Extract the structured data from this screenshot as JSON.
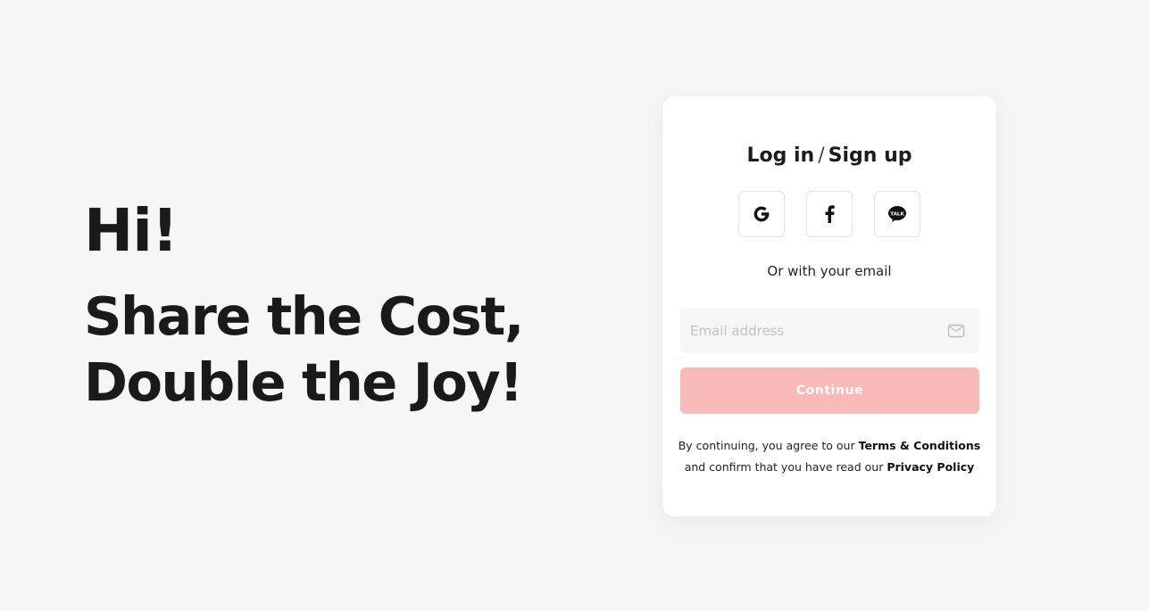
{
  "hero": {
    "greeting": "Hi!",
    "tagline_line1": "Share the Cost,",
    "tagline_line2": "Double the Joy!"
  },
  "auth": {
    "title_login": "Log in",
    "title_separator": "/",
    "title_signup": "Sign up",
    "social": [
      {
        "name": "google",
        "icon": "google-icon"
      },
      {
        "name": "facebook",
        "icon": "facebook-icon"
      },
      {
        "name": "kakaotalk",
        "icon": "kakaotalk-icon",
        "icon_text": "TALK"
      }
    ],
    "or_text": "Or with your email",
    "email": {
      "placeholder": "Email address",
      "value": "",
      "icon": "mail-icon"
    },
    "continue_label": "Continue",
    "terms": {
      "line1_prefix": "By continuing, you agree to our ",
      "terms_link": "Terms & Conditions",
      "line2_prefix": "and confirm that you have read our ",
      "privacy_link": "Privacy Policy"
    }
  },
  "colors": {
    "background": "#f6f6f6",
    "card": "#ffffff",
    "continue_disabled": "#f8b9b9",
    "text": "#1c1c1c",
    "placeholder": "#c2c2c2"
  }
}
